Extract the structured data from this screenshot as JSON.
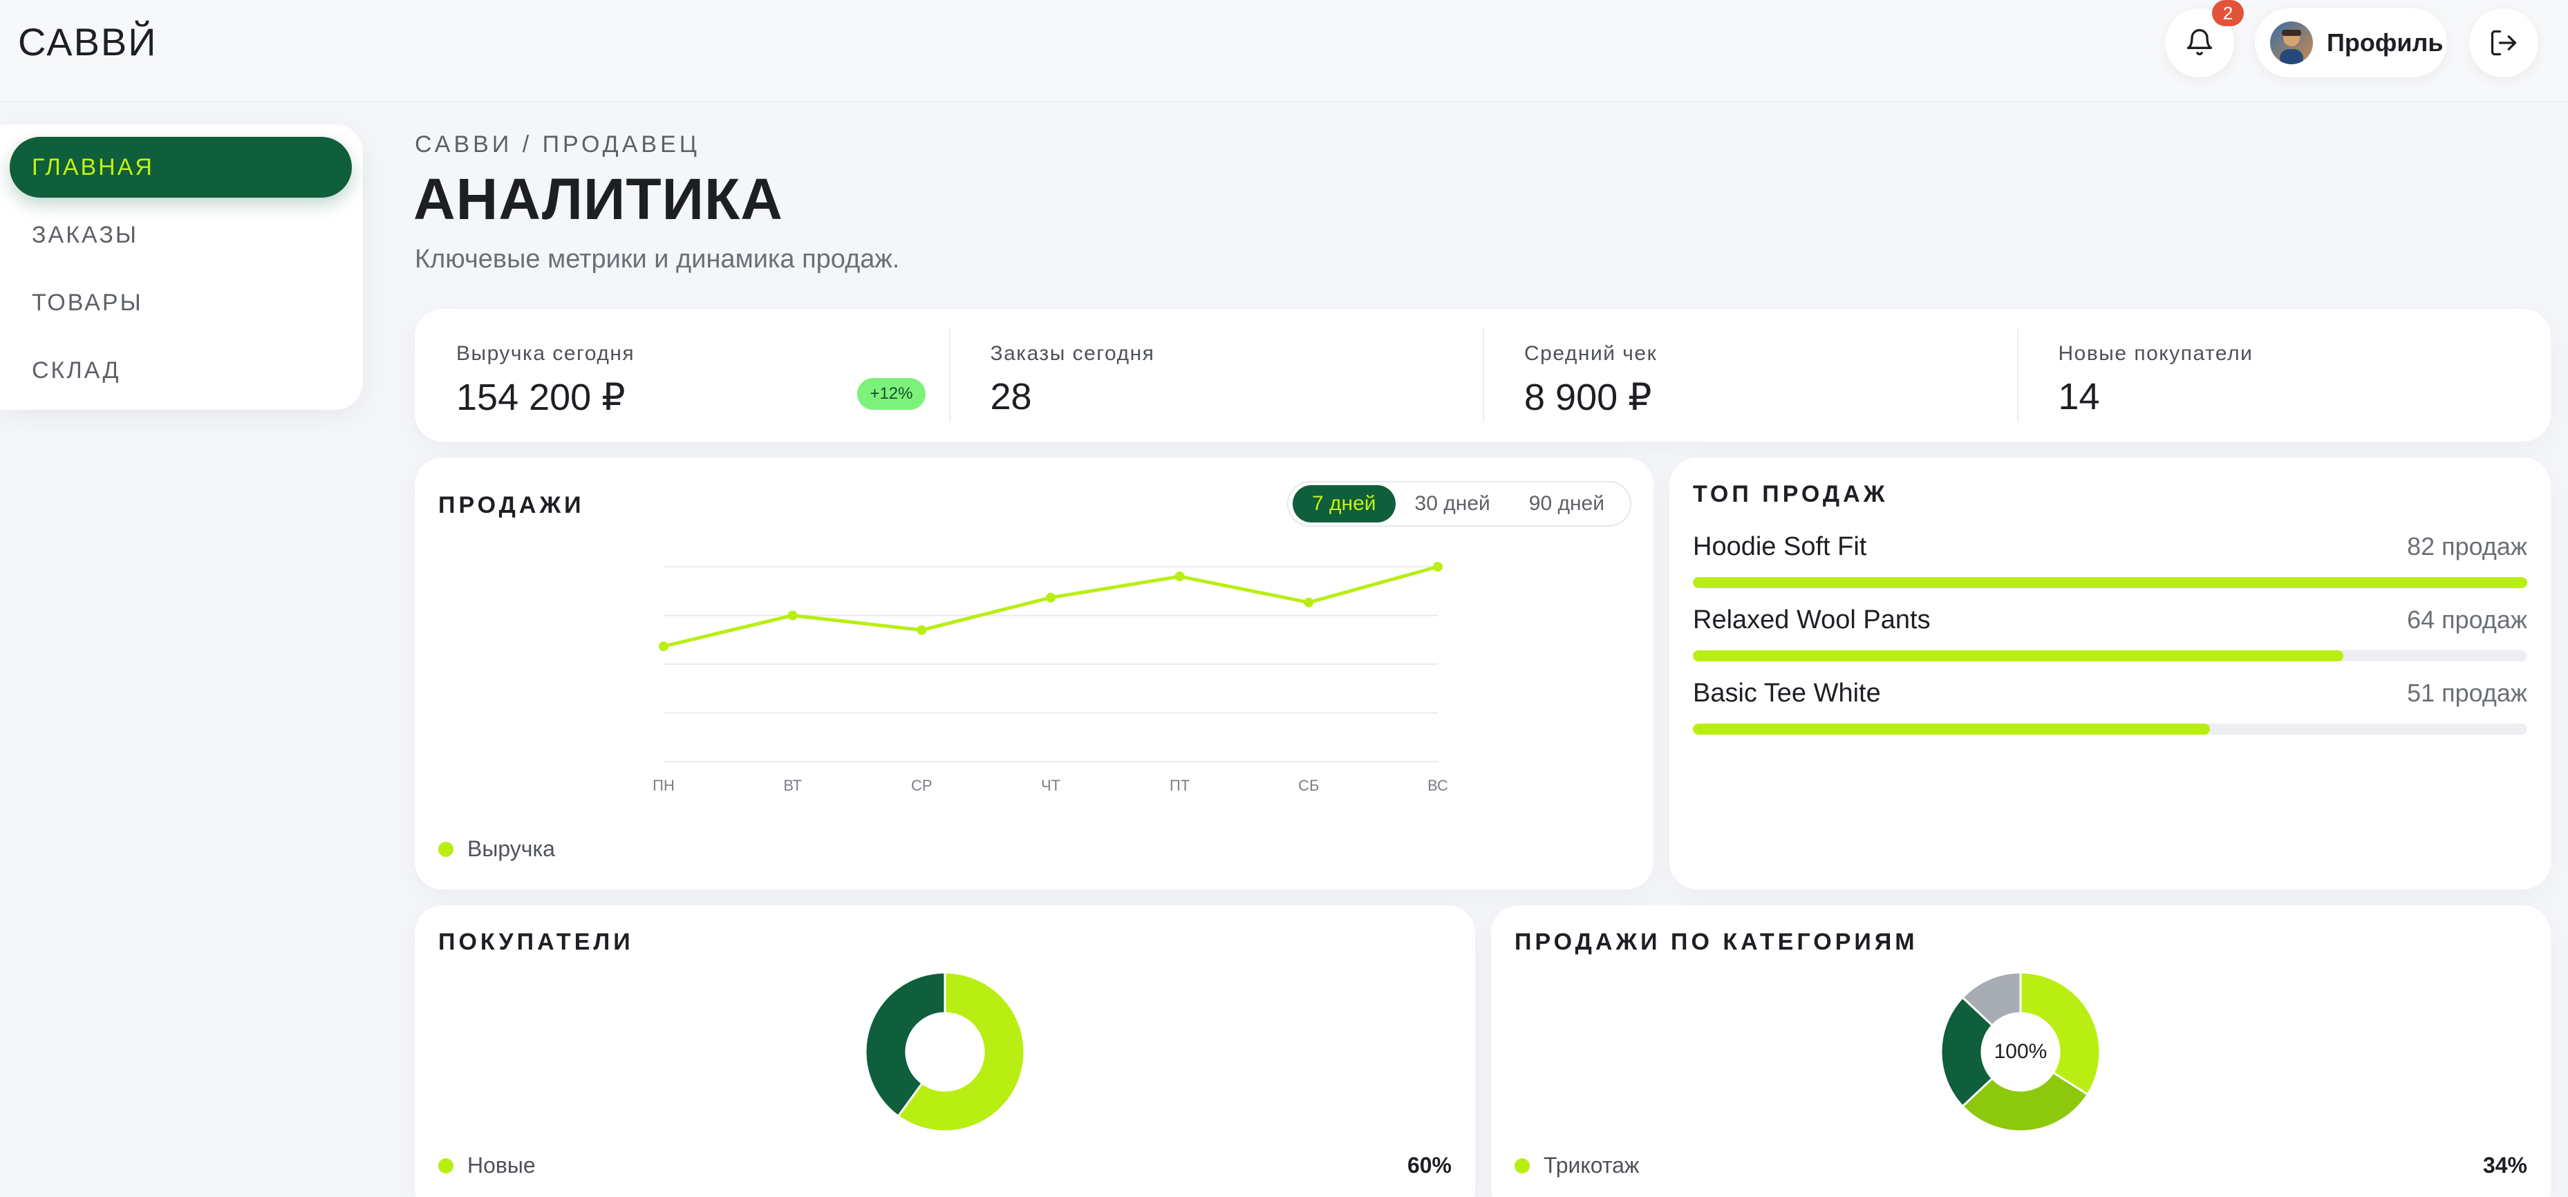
{
  "header": {
    "brand": "САВВЙ",
    "notifications_count": "2",
    "profile_label": "Профиль",
    "icons": {
      "bell": "bell-icon",
      "logout": "logout-icon",
      "avatar": "avatar-image"
    }
  },
  "sidebar": {
    "items": [
      {
        "label": "ГЛАВНАЯ",
        "active": true
      },
      {
        "label": "ЗАКАЗЫ",
        "active": false
      },
      {
        "label": "ТОВАРЫ",
        "active": false
      },
      {
        "label": "СКЛАД",
        "active": false
      }
    ]
  },
  "page": {
    "breadcrumb": "САВВИ / ПРОДАВЕЦ",
    "title": "АНАЛИТИКА",
    "subtitle": "Ключевые метрики и динамика продаж."
  },
  "kpis": [
    {
      "label": "Выручка сегодня",
      "value": "154 200 ₽",
      "delta": "+12%"
    },
    {
      "label": "Заказы сегодня",
      "value": "28"
    },
    {
      "label": "Средний чек",
      "value": "8 900 ₽"
    },
    {
      "label": "Новые покупатели",
      "value": "14"
    }
  ],
  "sales": {
    "title": "ПРОДАЖИ",
    "ranges": [
      {
        "label": "7 дней",
        "active": true
      },
      {
        "label": "30 дней",
        "active": false
      },
      {
        "label": "90 дней",
        "active": false
      }
    ],
    "legend": "Выручка"
  },
  "chart_data": [
    {
      "type": "line",
      "categories": [
        "ПН",
        "ВТ",
        "СР",
        "ЧТ",
        "ПТ",
        "СБ",
        "ВС"
      ],
      "series": [
        {
          "name": "Выручка",
          "values": [
            71,
            90,
            81,
            101,
            114,
            98,
            120
          ]
        }
      ],
      "ylim": [
        0,
        120
      ],
      "grid": true,
      "legend": "bottom-left",
      "colors": {
        "line": "#b9ee12",
        "grid": "#e8eaee"
      }
    },
    {
      "type": "pie",
      "labels": [
        "Новые",
        ""
      ],
      "values": [
        60,
        40
      ],
      "colors": [
        "#b9ee12",
        "#0f5e3c"
      ]
    },
    {
      "type": "pie",
      "center_label": "100%",
      "labels": [
        "Трикотаж",
        "",
        "",
        ""
      ],
      "values": [
        34,
        29,
        24,
        13
      ],
      "colors": [
        "#b9ee12",
        "#8cc80c",
        "#0f5e3c",
        "#a8acb3"
      ]
    }
  ],
  "top_sales": {
    "title": "ТОП ПРОДАЖ",
    "items": [
      {
        "name": "Hoodie Soft Fit",
        "count": "82 продаж",
        "fraction": 1.0
      },
      {
        "name": "Relaxed Wool Pants",
        "count": "64 продаж",
        "fraction": 0.78
      },
      {
        "name": "Basic Tee White",
        "count": "51 продаж",
        "fraction": 0.62
      }
    ]
  },
  "buyers": {
    "title": "ПОКУПАТЕЛИ",
    "row_label": "Новые",
    "row_value": "60%"
  },
  "categories": {
    "title": "ПРОДАЖИ ПО КАТЕГОРИЯМ",
    "row_label": "Трикотаж",
    "row_value": "34%"
  },
  "colors": {
    "accent": "#b9ee12",
    "brand_dark": "#0f5e3c",
    "badge": "#e2533a"
  }
}
